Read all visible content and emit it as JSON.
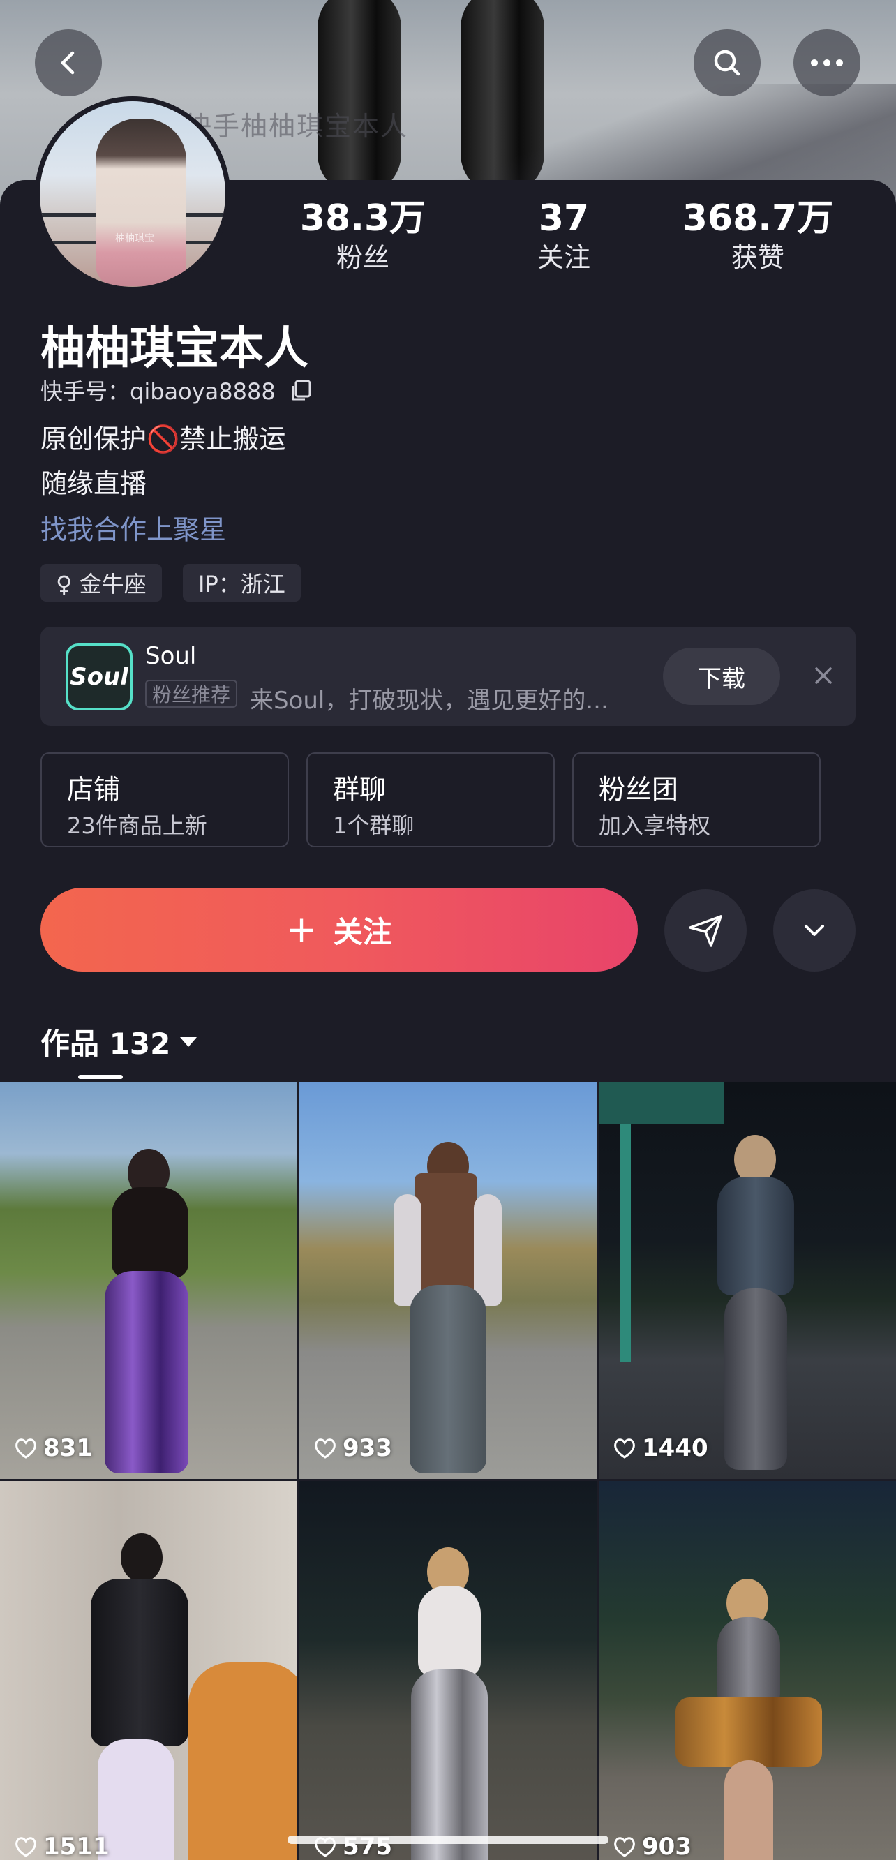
{
  "header": {
    "cover_watermark": "快手柚柚琪宝本人"
  },
  "profile": {
    "name": "柚柚琪宝本人",
    "kuaishou_id": "快手号：qibaoya8888",
    "bio_line1": "原创保护🚫禁止搬运",
    "bio_line2": "随缘直播",
    "link_text": "找我合作上聚星",
    "tags": [
      "♀ 金牛座",
      "IP：浙江"
    ],
    "avatar_watermark": "柚柚琪宝"
  },
  "stats": [
    {
      "value": "38.3万",
      "label": "粉丝"
    },
    {
      "value": "37",
      "label": "关注"
    },
    {
      "value": "368.7万",
      "label": "获赞"
    }
  ],
  "ad": {
    "logo_text": "Soul",
    "title": "Soul",
    "badge": "粉丝推荐",
    "description": "来Soul，打破现状，遇见更好的...",
    "button": "下载"
  },
  "cards": [
    {
      "title": "店铺",
      "subtitle": "23件商品上新"
    },
    {
      "title": "群聊",
      "subtitle": "1个群聊"
    },
    {
      "title": "粉丝团",
      "subtitle": "加入享特权"
    }
  ],
  "actions": {
    "follow_label": "关注",
    "follow_plus": "+"
  },
  "works_tab": {
    "label": "作品 132"
  },
  "videos": [
    {
      "likes": "831"
    },
    {
      "likes": "933"
    },
    {
      "likes": "1440"
    },
    {
      "likes": "1511"
    },
    {
      "likes": "575"
    },
    {
      "likes": "903"
    }
  ],
  "colors": {
    "background": "#1c1c26",
    "follow_gradient_start": "#f3664e",
    "follow_gradient_end": "#e8446a",
    "link": "#7f95c9",
    "soul_accent": "#56e0c8"
  }
}
